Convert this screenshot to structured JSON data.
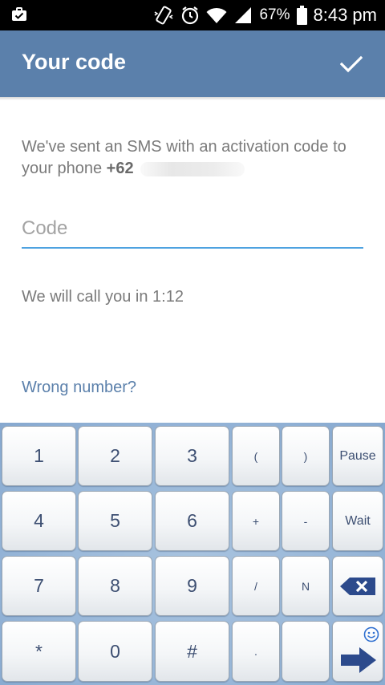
{
  "status_bar": {
    "battery_percent": "67%",
    "time": "8:43 pm",
    "icons": [
      "briefcase-check-icon",
      "vibrate-icon",
      "alarm-icon",
      "wifi-icon",
      "signal-icon",
      "battery-icon"
    ]
  },
  "app_bar": {
    "title": "Your code",
    "done_icon": "checkmark-icon"
  },
  "body": {
    "message": "We've sent an SMS with an activation code to your phone",
    "phone_prefix": "+62",
    "code_placeholder": "Code",
    "call_timer": "We will call you in 1:12",
    "wrong_number": "Wrong number?"
  },
  "keyboard": {
    "rows": [
      [
        "1",
        "2",
        "3",
        "(",
        ")",
        "Pause"
      ],
      [
        "4",
        "5",
        "6",
        "+",
        "-",
        "Wait"
      ],
      [
        "7",
        "8",
        "9",
        "/",
        "N",
        ""
      ],
      [
        "*",
        "0",
        "#",
        ".",
        "",
        ""
      ]
    ],
    "icons": {
      "backspace": "backspace-icon",
      "enter": "arrow-right-icon",
      "emoji": "smiley-icon"
    }
  },
  "colors": {
    "app_bar": "#5b80ab",
    "accent_underline": "#4ea2e0",
    "link": "#5b80ab",
    "key_text": "#3d4f72",
    "keyboard_bg": "#97b6d8"
  }
}
